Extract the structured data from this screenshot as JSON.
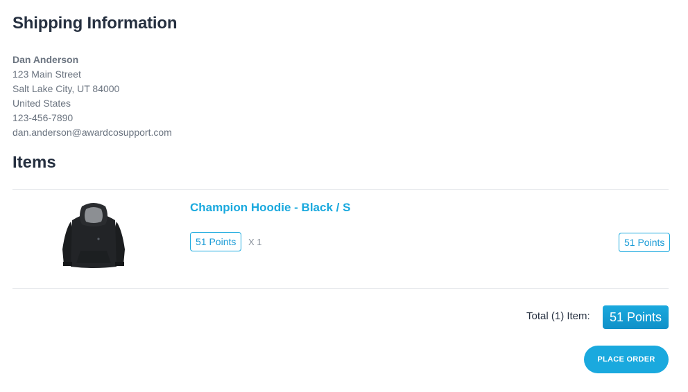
{
  "shipping": {
    "title": "Shipping Information",
    "name": "Dan Anderson",
    "street": "123 Main Street",
    "city_state_zip": "Salt Lake City, UT 84000",
    "country": "United States",
    "phone": "123-456-7890",
    "email": "dan.anderson@awardcosupport.com"
  },
  "items_section": {
    "title": "Items",
    "items": [
      {
        "name": "Champion Hoodie - Black / S",
        "unit_price": "51 Points",
        "quantity": "X 1",
        "line_total": "51 Points",
        "image_icon": "hoodie-image"
      }
    ]
  },
  "summary": {
    "total_label": "Total (1) Item:",
    "total_value": "51 Points",
    "place_order_label": "PLACE ORDER"
  },
  "colors": {
    "accent": "#1aa9de",
    "heading": "#263040",
    "muted": "#6b7480"
  }
}
